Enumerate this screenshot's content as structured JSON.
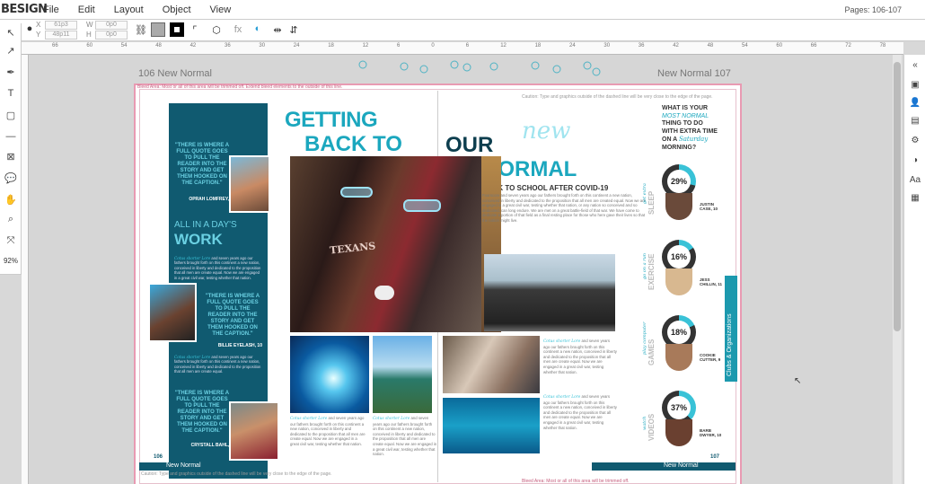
{
  "app": {
    "logo": "BESIGN",
    "menu": [
      "File",
      "Edit",
      "Layout",
      "Object",
      "View"
    ],
    "pages_indicator": "Pages: 106-107"
  },
  "optionbar": {
    "x_label": "X",
    "x_value": "61p3",
    "y_label": "Y",
    "y_value": "48p11",
    "w_label": "W",
    "w_value": "0p0",
    "h_label": "H",
    "h_value": "0p0"
  },
  "toolbar": {
    "zoom": "92%"
  },
  "ruler": {
    "ticks": [
      "66",
      "60",
      "54",
      "48",
      "42",
      "36",
      "30",
      "24",
      "18",
      "12",
      "6",
      "0",
      "6",
      "12",
      "18",
      "24",
      "30",
      "36",
      "42",
      "48",
      "54",
      "60",
      "66",
      "72",
      "78"
    ]
  },
  "spread": {
    "left_page_header": "106  New Normal",
    "right_page_header": "New Normal  107",
    "bleed_note": "Bleed Area: Most or all of this area will be trimmed off. Extend bleed elements to the outside of this line.",
    "caution_note": "Caution: Type and graphics outside of the dashed line will be very close to the edge of the page.",
    "bottom_note_left": "Caution: Type and graphics outside of the dashed line will be very close to the edge of the page.",
    "bottom_note_right": "Bleed Area: Most or all of this area will be trimmed off.",
    "footer_left": "New Normal",
    "footer_right": "New Normal",
    "folio_left": "106",
    "folio_right": "107"
  },
  "left_column": {
    "quote1": "\"THERE IS WHERE A FULL QUOTE GOES TO PULL THE READER INTO THE STORY AND GET THEM HOOKED ON THE CAPTION.\"",
    "quote1_name": "OPRAH LOMFREY, 12",
    "section_title_small": "ALL IN A DAY'S",
    "section_title_big": "WORK",
    "script_lead": "Cotus shorter Lore",
    "body1": "and seven years ago our fathers brought forth on this continent a new nation, conceived in liberty and dedicated to the proposition that all men are create equal. Now we are engaged in a great civil war, testing whether that nation.",
    "quote2": "\"THERE IS WHERE A FULL QUOTE GOES TO PULL THE READER INTO THE STORY AND GET THEM HOOKED ON THE CAPTION.\"",
    "quote2_name": "BILLIE EYELASH, 10",
    "body2": "and seven years ago our fathers brought forth on this continent a new nation, conceived in liberty and dedicated to the proposition that all men are create equal.",
    "quote3": "\"THERE IS WHERE A FULL QUOTE GOES TO PULL THE READER INTO THE STORY AND GET THEM HOOKED ON THE CAPTION.\"",
    "quote3_name": "CRYSTALL BAHL, 11"
  },
  "headline": {
    "getting": "GETTING",
    "back_to": "BACK TO",
    "our": "OUR",
    "new": "new",
    "normal": "NORMAL",
    "subhead": "BACK TO SCHOOL AFTER COVID-19"
  },
  "story": {
    "body": "Foarscore and seven years ago our fathers brought forth on this continent a new nation, conceived in liberty and dedicated to the proposition that all men are created equal. Now we are engaged in a great civil war, testing whether that nation, or any nation so conceived and so dedicated, can long endure. We are met on a great battle-field of that war. We have come to dedicate a portion of that field as a final resting place for those who here gave their lives so that the nation might live."
  },
  "captions": {
    "script_lead": "Cotus shorter Lore",
    "caption_text": "and seven years ago our fathers brought forth on this continent a new nation, conceived in liberty and dedicated to the proposition that all men are create equal. Now we are engaged in a great civil war, testing whether that nation."
  },
  "right_column": {
    "question_1": "WHAT IS YOUR",
    "question_2": "MOST NORMAL",
    "question_3": "THING TO DO",
    "question_4": "WITH EXTRA TIME",
    "question_5": "ON A",
    "question_6": "Saturday",
    "question_7": "MORNING?",
    "stats": [
      {
        "percent": "29%",
        "label": "SLEEP",
        "prefix": "get extra",
        "name": "JUSTIN CASE, 10",
        "fill": 0.29
      },
      {
        "percent": "16%",
        "label": "EXERCISE",
        "prefix": "go on a run",
        "name": "JESS CHILLIN, 11",
        "fill": 0.16
      },
      {
        "percent": "18%",
        "label": "GAMES",
        "prefix": "play computer",
        "name": "COOKIE CUTTER, 9",
        "fill": 0.18
      },
      {
        "percent": "37%",
        "label": "VIDEOS",
        "prefix": "watch",
        "name": "BARB DWYER, 10",
        "fill": 0.37
      }
    ]
  },
  "side_tab": {
    "label": "Clubs & Organizations"
  },
  "colors": {
    "teal_dark": "#105a70",
    "teal": "#1ba7be",
    "bleed_pink": "#e89ab2"
  }
}
